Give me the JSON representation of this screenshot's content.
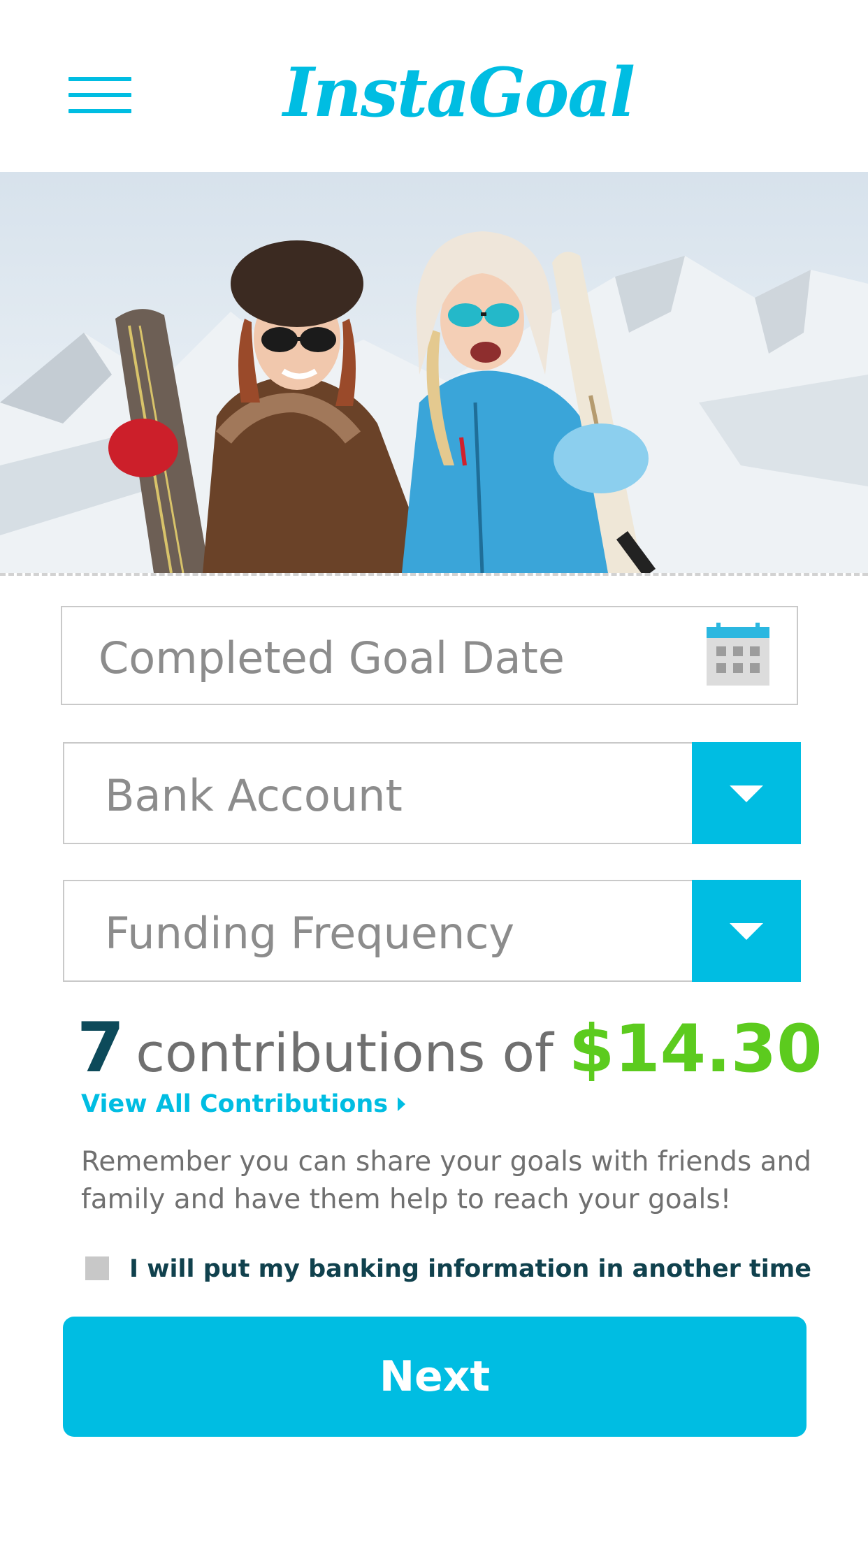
{
  "header": {
    "menu_icon": "hamburger-menu-icon",
    "logo": "InstaGoal"
  },
  "hero": {
    "image": "two smiling women holding skis on a snowy mountain"
  },
  "form": {
    "date_placeholder": "Completed Goal Date",
    "calendar_icon": "calendar-icon",
    "bank_account": "Bank Account",
    "funding_frequency": "Funding Frequency"
  },
  "summary": {
    "count": "7",
    "text": "contributions of",
    "amount": "$14.30",
    "view_all_label": "View All Contributions"
  },
  "note": "Remember you can share your goals with friends and family and have them help to reach your goals!",
  "checkbox_label": "I will put my banking information in another time",
  "next_label": "Next",
  "colors": {
    "accent": "#00bde2",
    "amount_green": "#5ccb1e",
    "count_dark": "#0d4a5a"
  }
}
